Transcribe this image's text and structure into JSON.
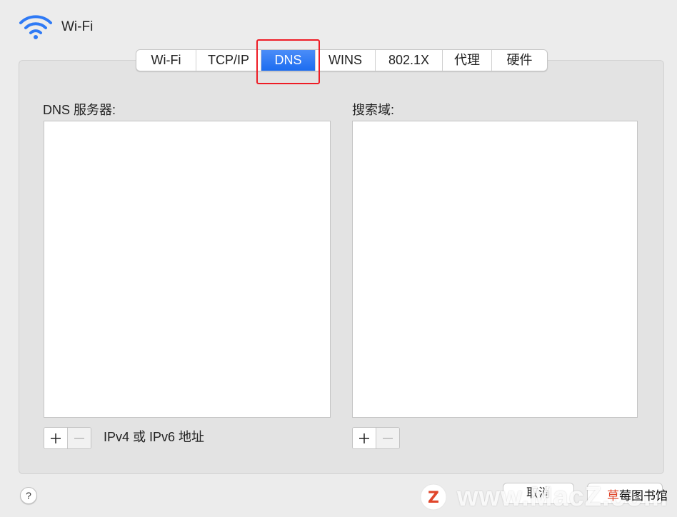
{
  "window": {
    "title": "Wi-Fi",
    "title_icon": "wifi-icon",
    "accent_color": "#2f7af5"
  },
  "tabs": [
    {
      "label": "Wi-Fi",
      "active": false
    },
    {
      "label": "TCP/IP",
      "active": false
    },
    {
      "label": "DNS",
      "active": true
    },
    {
      "label": "WINS",
      "active": false
    },
    {
      "label": "802.1X",
      "active": false
    },
    {
      "label": "代理",
      "active": false
    },
    {
      "label": "硬件",
      "active": false
    }
  ],
  "annotation": {
    "color": "#ee1c25",
    "target": "DNS"
  },
  "dns": {
    "servers_label": "DNS 服务器:",
    "servers": [],
    "search_domains_label": "搜索域:",
    "search_domains": [],
    "hint": "IPv4 或 IPv6 地址",
    "add_icon": "plus-icon",
    "remove_icon": "minus-icon"
  },
  "footer": {
    "help_label": "?",
    "cancel_label": "取消"
  },
  "watermark": {
    "logo_letter": "Z",
    "logo_color": "#e0462b",
    "text": "www.MacZ.com",
    "sub_accent": "草",
    "sub_text": "莓图书馆"
  }
}
